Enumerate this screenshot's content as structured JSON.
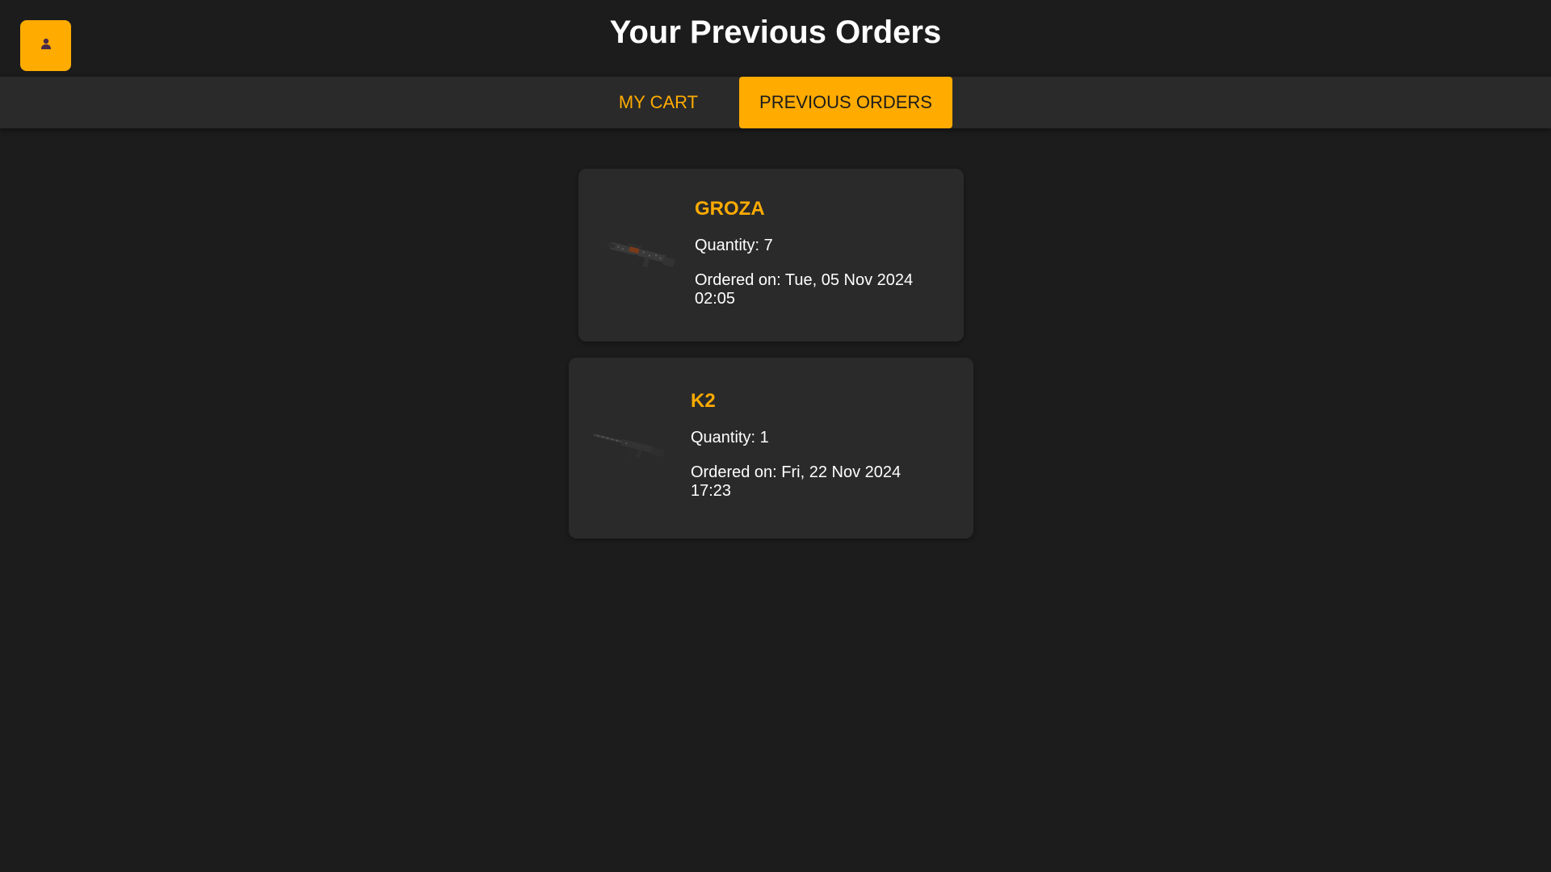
{
  "header": {
    "title": "Your Previous Orders",
    "profile_icon": "user-icon"
  },
  "tabs": [
    {
      "label": "MY CART",
      "active": false
    },
    {
      "label": "PREVIOUS ORDERS",
      "active": true
    }
  ],
  "orders": [
    {
      "name": "GROZA",
      "quantity_text": "Quantity: 7",
      "ordered_on_text": "Ordered on: Tue, 05 Nov 2024 02:05",
      "image_icon": "groza-rifle-image"
    },
    {
      "name": "K2",
      "quantity_text": "Quantity: 1",
      "ordered_on_text": "Ordered on: Fri, 22 Nov 2024 17:23",
      "image_icon": "k2-rifle-image"
    }
  ],
  "colors": {
    "background": "#1c1c1c",
    "panel": "#2a2a2a",
    "accent": "#ffab00",
    "text": "#ffffff"
  }
}
